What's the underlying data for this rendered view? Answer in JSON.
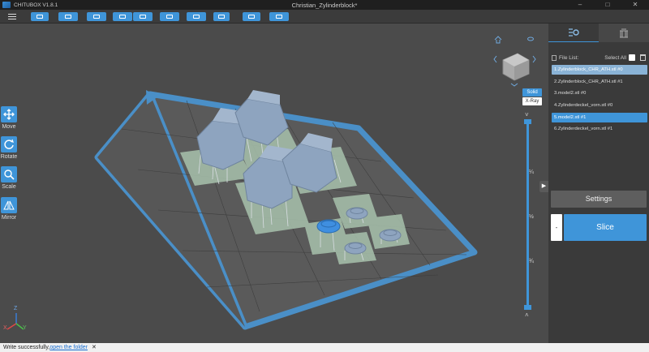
{
  "app": {
    "name": "CHITUBOX V1.8.1",
    "document_title": "Christian_Zylinderblock*"
  },
  "window_controls": {
    "minimize": "–",
    "maximize": "□",
    "close": "✕"
  },
  "toolbar": {
    "buttons": [
      {
        "icon": "open-file-icon"
      },
      {
        "icon": "save-file-icon"
      },
      {
        "icon": "layout-icon"
      },
      {
        "icon": "undo-icon"
      },
      {
        "icon": "redo-icon"
      },
      {
        "icon": "support-icon"
      },
      {
        "icon": "hollow-icon"
      },
      {
        "icon": "drip-icon"
      },
      {
        "icon": "frame-icon"
      },
      {
        "icon": "export-icon"
      }
    ]
  },
  "left_tools": [
    {
      "label": "Move",
      "icon": "move-icon"
    },
    {
      "label": "Rotate",
      "icon": "rotate-icon"
    },
    {
      "label": "Scale",
      "icon": "scale-icon"
    },
    {
      "label": "Mirror",
      "icon": "mirror-icon"
    }
  ],
  "view_modes": {
    "solid": "Solid",
    "xray": "X-Ray",
    "active": "Solid"
  },
  "layer_slider": {
    "labels": [
      "¼",
      "½",
      "¾"
    ],
    "up_arrow": "˅",
    "down_arrow": "˄"
  },
  "axes": {
    "x": "X",
    "y": "Y",
    "z": "Z"
  },
  "panel": {
    "file_list_label": "File List:",
    "select_all_label": "Select All",
    "files": [
      {
        "label": "1.Zylinderblock_CHR_ATH.stl #0",
        "state": "highlighted"
      },
      {
        "label": "2.Zylinderblock_CHR_ATH.stl #1",
        "state": "normal"
      },
      {
        "label": "3.model2.stl #0",
        "state": "normal"
      },
      {
        "label": "4.Zylinderdeckel_vorn.stl #0",
        "state": "normal"
      },
      {
        "label": "5.model2.stl #1",
        "state": "selected"
      },
      {
        "label": "6.Zylinderdeckel_vorn.stl #1",
        "state": "normal"
      }
    ],
    "settings_label": "Settings",
    "minus_label": "-",
    "slice_label": "Slice"
  },
  "status": {
    "message": "Write successfully,",
    "link": "open the folder",
    "close": "✕"
  },
  "colors": {
    "accent": "#3f95d9",
    "viewport": "#4b4b4b",
    "plate": "#4a8fc7",
    "model": "#8ea4bf"
  }
}
